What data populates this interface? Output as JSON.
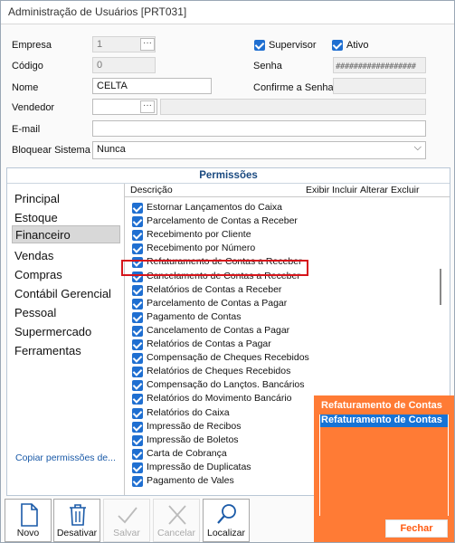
{
  "window": {
    "title": "Administração de Usuários [PRT031]"
  },
  "form": {
    "empresa_label": "Empresa",
    "empresa_value": "1",
    "codigo_label": "Código",
    "codigo_value": "0",
    "nome_label": "Nome",
    "nome_value": "CELTA",
    "vendedor_label": "Vendedor",
    "vendedor_value": "",
    "email_label": "E-mail",
    "email_value": "",
    "bloquear_label": "Bloquear Sistema",
    "bloquear_value": "Nunca",
    "supervisor_label": "Supervisor",
    "ativo_label": "Ativo",
    "senha_label": "Senha",
    "senha_value": "##################",
    "confirme_label": "Confirme a Senha",
    "lookup_dots": "···",
    "chevron": "⌵"
  },
  "permissoes": {
    "title": "Permissões",
    "menu": [
      {
        "label": "Principal"
      },
      {
        "label": "Estoque"
      },
      {
        "label": "Financeiro"
      },
      {
        "label": "Vendas"
      },
      {
        "label": "Compras"
      },
      {
        "label": "Contábil Gerencial"
      },
      {
        "label": "Pessoal"
      },
      {
        "label": "Supermercado"
      },
      {
        "label": "Ferramentas"
      }
    ],
    "copy_link": "Copiar permissões de...",
    "columns": [
      "Descrição",
      "Exibir",
      "Incluir",
      "Alterar",
      "Excluir"
    ],
    "rows": [
      "Estornar Lançamentos do Caixa",
      "Parcelamento de Contas a Receber",
      "Recebimento por Cliente",
      "Recebimento por Número",
      "Refaturamento de Contas a Receber",
      "Cancelamento de Contas a Receber",
      "Relatórios de Contas a Receber",
      "Parcelamento de Contas a Pagar",
      "Pagamento de Contas",
      "Cancelamento de Contas a Pagar",
      "Relatórios de Contas a Pagar",
      "Compensação de Cheques Recebidos",
      "Relatórios de Cheques Recebidos",
      "Compensação do Lançtos. Bancários",
      "Relatórios do Movimento Bancário",
      "Relatórios do Caixa",
      "Impressão de Recibos",
      "Impressão de Boletos",
      "Carta de Cobrança",
      "Impressão de Duplicatas",
      "Pagamento de Vales"
    ]
  },
  "toolbar": {
    "novo": "Novo",
    "desativar": "Desativar",
    "salvar": "Salvar",
    "cancelar": "Cancelar",
    "localizar": "Localizar"
  },
  "popup": {
    "line1": "Refaturamento de Contas",
    "line2": "Refaturamento de Contas",
    "close": "Fechar"
  },
  "colors": {
    "accent": "#1f6fd1",
    "popup": "#ff7b35",
    "highlight": "#d6151b"
  }
}
